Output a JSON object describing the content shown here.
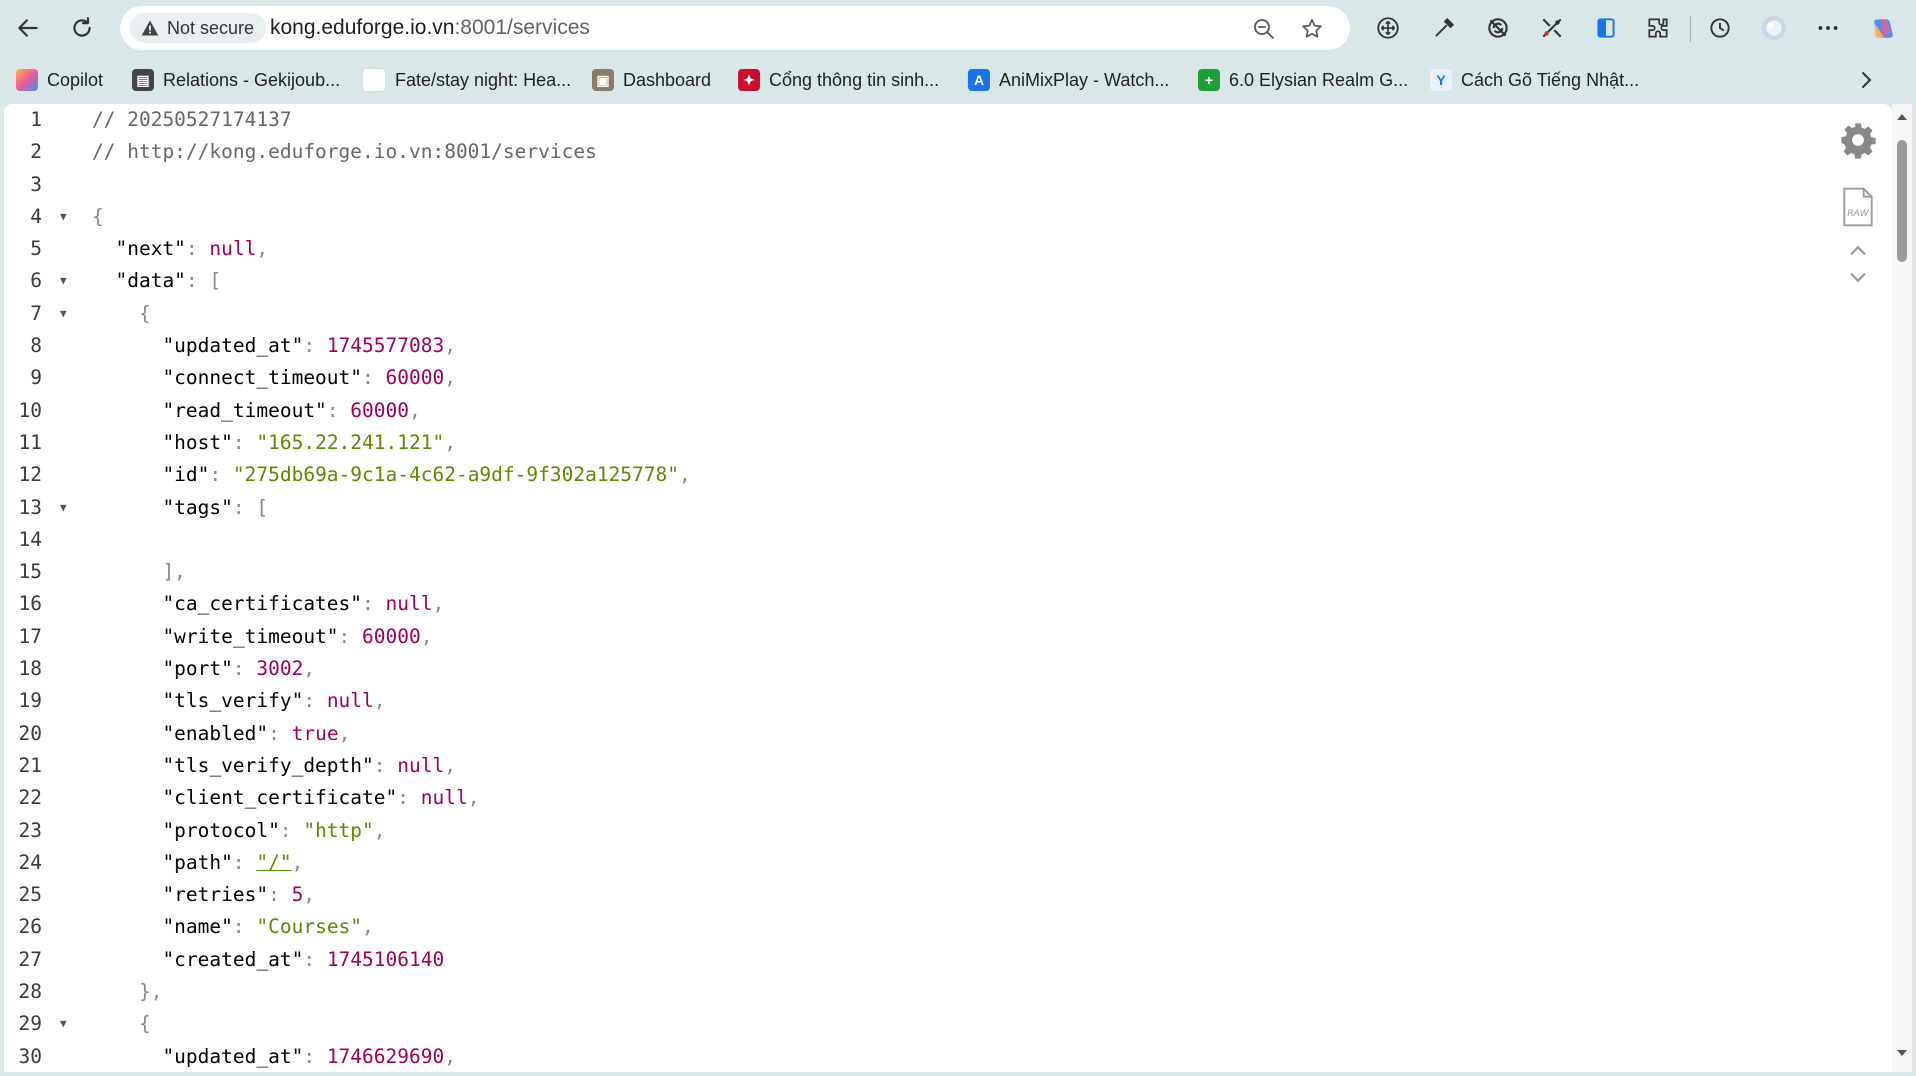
{
  "browser": {
    "security_label": "Not secure",
    "url_host": "kong.eduforge.io.vn",
    "url_rest": ":8001/services"
  },
  "bookmarks": [
    {
      "label": "Copilot",
      "icon": "copilot-icon",
      "color": "#e25b3e"
    },
    {
      "label": "Relations - Gekijoub...",
      "icon": "clapper-icon",
      "color": "#444444"
    },
    {
      "label": "Fate/stay night: Hea...",
      "icon": "blank-page-icon",
      "color": "#ffffff"
    },
    {
      "label": "Dashboard",
      "icon": "dashboard-icon",
      "color": "#8a7a6a"
    },
    {
      "label": "Cổng thông tin sinh...",
      "icon": "university-icon",
      "color": "#c8102e"
    },
    {
      "label": "AniMixPlay - Watch...",
      "icon": "animix-icon",
      "color": "#1a73e8"
    },
    {
      "label": "6.0 Elysian Realm G...",
      "icon": "plus-icon",
      "color": "#1e9e3a"
    },
    {
      "label": "Cách Gõ Tiếng Nhật...",
      "icon": "y-icon",
      "color": "#e8f0ff"
    }
  ],
  "json_viewer": {
    "lines": [
      {
        "n": "1",
        "fold": false,
        "tokens": [
          {
            "t": "comment",
            "v": "// 20250527174137"
          }
        ]
      },
      {
        "n": "2",
        "fold": false,
        "tokens": [
          {
            "t": "comment",
            "v": "// http://kong.eduforge.io.vn:8001/services"
          }
        ]
      },
      {
        "n": "3",
        "fold": false,
        "tokens": []
      },
      {
        "n": "4",
        "fold": true,
        "tokens": [
          {
            "t": "punct",
            "v": "{"
          }
        ]
      },
      {
        "n": "5",
        "fold": false,
        "tokens": [
          {
            "t": "key",
            "v": "  \"next\""
          },
          {
            "t": "punct",
            "v": ": "
          },
          {
            "t": "null",
            "v": "null"
          },
          {
            "t": "punct",
            "v": ","
          }
        ]
      },
      {
        "n": "6",
        "fold": true,
        "tokens": [
          {
            "t": "key",
            "v": "  \"data\""
          },
          {
            "t": "punct",
            "v": ": ["
          }
        ]
      },
      {
        "n": "7",
        "fold": true,
        "tokens": [
          {
            "t": "punct",
            "v": "    {"
          }
        ]
      },
      {
        "n": "8",
        "fold": false,
        "tokens": [
          {
            "t": "key",
            "v": "      \"updated_at\""
          },
          {
            "t": "punct",
            "v": ": "
          },
          {
            "t": "num",
            "v": "1745577083"
          },
          {
            "t": "punct",
            "v": ","
          }
        ]
      },
      {
        "n": "9",
        "fold": false,
        "tokens": [
          {
            "t": "key",
            "v": "      \"connect_timeout\""
          },
          {
            "t": "punct",
            "v": ": "
          },
          {
            "t": "num",
            "v": "60000"
          },
          {
            "t": "punct",
            "v": ","
          }
        ]
      },
      {
        "n": "10",
        "fold": false,
        "tokens": [
          {
            "t": "key",
            "v": "      \"read_timeout\""
          },
          {
            "t": "punct",
            "v": ": "
          },
          {
            "t": "num",
            "v": "60000"
          },
          {
            "t": "punct",
            "v": ","
          }
        ]
      },
      {
        "n": "11",
        "fold": false,
        "tokens": [
          {
            "t": "key",
            "v": "      \"host\""
          },
          {
            "t": "punct",
            "v": ": "
          },
          {
            "t": "str",
            "v": "\"165.22.241.121\""
          },
          {
            "t": "punct",
            "v": ","
          }
        ]
      },
      {
        "n": "12",
        "fold": false,
        "tokens": [
          {
            "t": "key",
            "v": "      \"id\""
          },
          {
            "t": "punct",
            "v": ": "
          },
          {
            "t": "str",
            "v": "\"275db69a-9c1a-4c62-a9df-9f302a125778\""
          },
          {
            "t": "punct",
            "v": ","
          }
        ]
      },
      {
        "n": "13",
        "fold": true,
        "tokens": [
          {
            "t": "key",
            "v": "      \"tags\""
          },
          {
            "t": "punct",
            "v": ": ["
          }
        ]
      },
      {
        "n": "14",
        "fold": false,
        "tokens": []
      },
      {
        "n": "15",
        "fold": false,
        "tokens": [
          {
            "t": "punct",
            "v": "      ],"
          }
        ]
      },
      {
        "n": "16",
        "fold": false,
        "tokens": [
          {
            "t": "key",
            "v": "      \"ca_certificates\""
          },
          {
            "t": "punct",
            "v": ": "
          },
          {
            "t": "null",
            "v": "null"
          },
          {
            "t": "punct",
            "v": ","
          }
        ]
      },
      {
        "n": "17",
        "fold": false,
        "tokens": [
          {
            "t": "key",
            "v": "      \"write_timeout\""
          },
          {
            "t": "punct",
            "v": ": "
          },
          {
            "t": "num",
            "v": "60000"
          },
          {
            "t": "punct",
            "v": ","
          }
        ]
      },
      {
        "n": "18",
        "fold": false,
        "tokens": [
          {
            "t": "key",
            "v": "      \"port\""
          },
          {
            "t": "punct",
            "v": ": "
          },
          {
            "t": "num",
            "v": "3002"
          },
          {
            "t": "punct",
            "v": ","
          }
        ]
      },
      {
        "n": "19",
        "fold": false,
        "tokens": [
          {
            "t": "key",
            "v": "      \"tls_verify\""
          },
          {
            "t": "punct",
            "v": ": "
          },
          {
            "t": "null",
            "v": "null"
          },
          {
            "t": "punct",
            "v": ","
          }
        ]
      },
      {
        "n": "20",
        "fold": false,
        "tokens": [
          {
            "t": "key",
            "v": "      \"enabled\""
          },
          {
            "t": "punct",
            "v": ": "
          },
          {
            "t": "bool",
            "v": "true"
          },
          {
            "t": "punct",
            "v": ","
          }
        ]
      },
      {
        "n": "21",
        "fold": false,
        "tokens": [
          {
            "t": "key",
            "v": "      \"tls_verify_depth\""
          },
          {
            "t": "punct",
            "v": ": "
          },
          {
            "t": "null",
            "v": "null"
          },
          {
            "t": "punct",
            "v": ","
          }
        ]
      },
      {
        "n": "22",
        "fold": false,
        "tokens": [
          {
            "t": "key",
            "v": "      \"client_certificate\""
          },
          {
            "t": "punct",
            "v": ": "
          },
          {
            "t": "null",
            "v": "null"
          },
          {
            "t": "punct",
            "v": ","
          }
        ]
      },
      {
        "n": "23",
        "fold": false,
        "tokens": [
          {
            "t": "key",
            "v": "      \"protocol\""
          },
          {
            "t": "punct",
            "v": ": "
          },
          {
            "t": "str",
            "v": "\"http\""
          },
          {
            "t": "punct",
            "v": ","
          }
        ]
      },
      {
        "n": "24",
        "fold": false,
        "tokens": [
          {
            "t": "key",
            "v": "      \"path\""
          },
          {
            "t": "punct",
            "v": ": "
          },
          {
            "t": "link",
            "v": "\"/\""
          },
          {
            "t": "punct",
            "v": ","
          }
        ]
      },
      {
        "n": "25",
        "fold": false,
        "tokens": [
          {
            "t": "key",
            "v": "      \"retries\""
          },
          {
            "t": "punct",
            "v": ": "
          },
          {
            "t": "num",
            "v": "5"
          },
          {
            "t": "punct",
            "v": ","
          }
        ]
      },
      {
        "n": "26",
        "fold": false,
        "tokens": [
          {
            "t": "key",
            "v": "      \"name\""
          },
          {
            "t": "punct",
            "v": ": "
          },
          {
            "t": "str",
            "v": "\"Courses\""
          },
          {
            "t": "punct",
            "v": ","
          }
        ]
      },
      {
        "n": "27",
        "fold": false,
        "tokens": [
          {
            "t": "key",
            "v": "      \"created_at\""
          },
          {
            "t": "punct",
            "v": ": "
          },
          {
            "t": "num",
            "v": "1745106140"
          }
        ]
      },
      {
        "n": "28",
        "fold": false,
        "tokens": [
          {
            "t": "punct",
            "v": "    },"
          }
        ]
      },
      {
        "n": "29",
        "fold": true,
        "tokens": [
          {
            "t": "punct",
            "v": "    {"
          }
        ]
      },
      {
        "n": "30",
        "fold": false,
        "tokens": [
          {
            "t": "key",
            "v": "      \"updated_at\""
          },
          {
            "t": "punct",
            "v": ": "
          },
          {
            "t": "num",
            "v": "1746629690"
          },
          {
            "t": "punct",
            "v": ","
          }
        ]
      }
    ]
  }
}
